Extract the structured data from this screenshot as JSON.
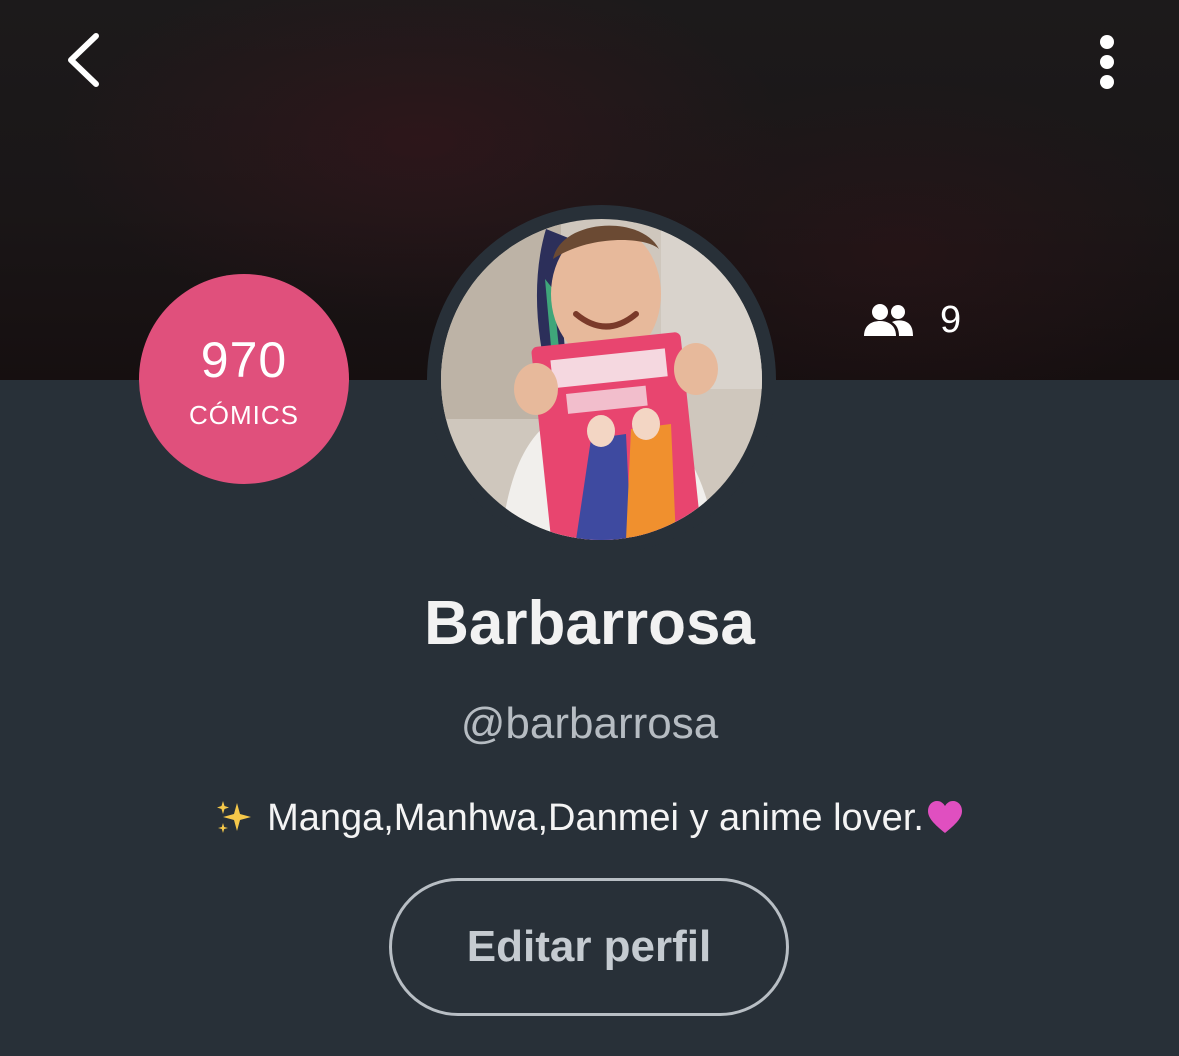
{
  "header": {
    "back_icon": "chevron-left-icon",
    "more_icon": "more-vertical-icon"
  },
  "stats": {
    "comics_count": "970",
    "comics_label": "CÓMICS",
    "followers_icon": "people-icon",
    "followers_count": "9",
    "comics_badge_color": "#e0507c"
  },
  "profile": {
    "display_name": "Barbarrosa",
    "username": "@barbarrosa",
    "bio_leading_icon": "sparkles-icon",
    "bio": "Manga,Manhwa,Danmei y anime lover.",
    "bio_trailing_icon": "heart-icon"
  },
  "actions": {
    "edit_label": "Editar perfil"
  },
  "colors": {
    "background": "#283038",
    "accent_pink": "#e0507c",
    "heart": "#e04fc0"
  }
}
